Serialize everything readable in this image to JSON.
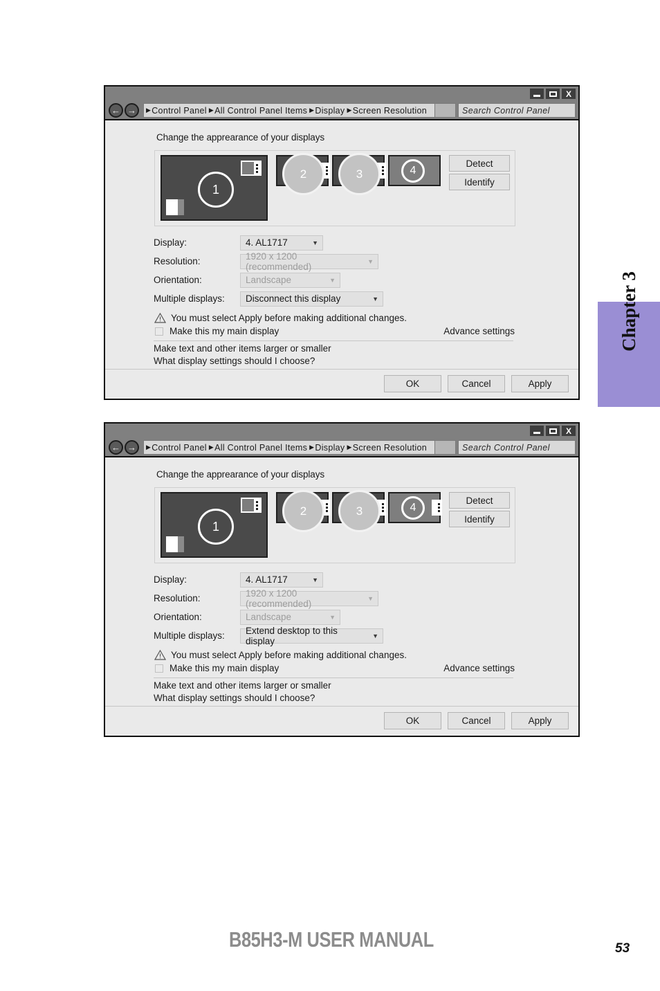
{
  "page": {
    "footer_title": "B85H3-M USER MANUAL",
    "page_number": "53",
    "chapter_tab": "Chapter 3"
  },
  "windows": [
    {
      "id": "window-1",
      "titlebar": {
        "minimize_label": "–",
        "maximize_label": "□",
        "close_label": "X"
      },
      "nav": {
        "back_icon": "←",
        "forward_icon": "→",
        "breadcrumbs": [
          "Control Panel",
          "All Control Panel Items",
          "Display",
          "Screen Resolution"
        ],
        "search_placeholder": "Search Control Panel"
      },
      "heading": "Change the apprearance of your displays",
      "monitors": [
        {
          "number": "1",
          "style": "primary",
          "has_taskicon": true,
          "has_strip": false
        },
        {
          "number": "2",
          "style": "filled",
          "has_taskicon": false,
          "has_strip": true
        },
        {
          "number": "3",
          "style": "filled",
          "has_taskicon": false,
          "has_strip": true
        },
        {
          "number": "4",
          "style": "selected",
          "has_taskicon": false,
          "has_strip": false
        }
      ],
      "side_buttons": [
        {
          "label": "Detect"
        },
        {
          "label": "Identify"
        }
      ],
      "fields": [
        {
          "label": "Display:",
          "value": "4. AL1717",
          "disabled": false
        },
        {
          "label": "Resolution:",
          "value": "1920 x 1200 (recommended)",
          "disabled": true
        },
        {
          "label": "Orientation:",
          "value": "Landscape",
          "disabled": true
        },
        {
          "label": "Multiple displays:",
          "value": "Disconnect this display",
          "disabled": false
        }
      ],
      "warning_text": "You must select Apply before making additional changes.",
      "checkbox_label": "Make this my main display",
      "advance_settings": "Advance settings",
      "link_1": "Make text and other items larger or smaller",
      "link_2": "What display settings should I choose?",
      "footer_buttons": [
        {
          "label": "OK"
        },
        {
          "label": "Cancel"
        },
        {
          "label": "Apply"
        }
      ]
    },
    {
      "id": "window-2",
      "titlebar": {
        "minimize_label": "–",
        "maximize_label": "□",
        "close_label": "X"
      },
      "nav": {
        "back_icon": "←",
        "forward_icon": "→",
        "breadcrumbs": [
          "Control Panel",
          "All Control Panel Items",
          "Display",
          "Screen Resolution"
        ],
        "search_placeholder": "Search Control Panel"
      },
      "heading": "Change the apprearance of your displays",
      "monitors": [
        {
          "number": "1",
          "style": "primary",
          "has_taskicon": true,
          "has_strip": false
        },
        {
          "number": "2",
          "style": "filled",
          "has_taskicon": false,
          "has_strip": true
        },
        {
          "number": "3",
          "style": "filled",
          "has_taskicon": false,
          "has_strip": true
        },
        {
          "number": "4",
          "style": "selected",
          "has_taskicon": false,
          "has_strip": true
        }
      ],
      "side_buttons": [
        {
          "label": "Detect"
        },
        {
          "label": "Identify"
        }
      ],
      "fields": [
        {
          "label": "Display:",
          "value": "4. AL1717",
          "disabled": false
        },
        {
          "label": "Resolution:",
          "value": "1920 x 1200 (recommended)",
          "disabled": true
        },
        {
          "label": "Orientation:",
          "value": "Landscape",
          "disabled": true
        },
        {
          "label": "Multiple displays:",
          "value": "Extend desktop to this display",
          "disabled": false
        }
      ],
      "warning_text": "You must select Apply before making additional changes.",
      "checkbox_label": "Make this my main display",
      "advance_settings": "Advance settings",
      "link_1": "Make text and other items larger or smaller",
      "link_2": "What display settings should I choose?",
      "footer_buttons": [
        {
          "label": "OK"
        },
        {
          "label": "Cancel"
        },
        {
          "label": "Apply"
        }
      ]
    }
  ],
  "colors": {
    "chapter_tab_purple": "#9a8ed4",
    "titlebar_gray": "#808080",
    "window_body": "#eaeaea",
    "monitor_dark": "#4a4a4a",
    "monitor_selected": "#7e7e7e",
    "footer_title_gray": "#8c8c8c"
  }
}
